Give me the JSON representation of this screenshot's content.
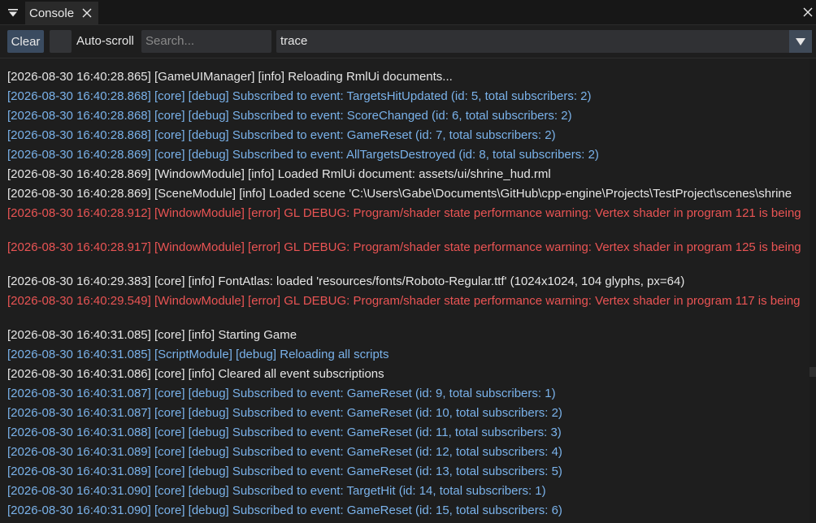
{
  "tab": {
    "label": "Console"
  },
  "toolbar": {
    "clear_label": "Clear",
    "autoscroll_label": "Auto-scroll",
    "autoscroll_checked": false,
    "search_placeholder": "Search...",
    "filter_value": "trace"
  },
  "colors": {
    "info": "#e6e6e6",
    "debug": "#7ab2ea",
    "error": "#ea5454",
    "accent_button": "#3a4b60"
  },
  "log": {
    "clipped_previous": "",
    "lines": [
      {
        "text": "[2026-08-30 16:40:28.865] [GameUIManager] [info] Reloading RmlUi documents...",
        "level": "info",
        "row": 0
      },
      {
        "text": "[2026-08-30 16:40:28.868] [core] [debug] Subscribed to event: TargetsHitUpdated (id: 5, total subscribers: 2)",
        "level": "debug",
        "row": 1
      },
      {
        "text": "[2026-08-30 16:40:28.868] [core] [debug] Subscribed to event: ScoreChanged (id: 6, total subscribers: 2)",
        "level": "debug",
        "row": 2
      },
      {
        "text": "[2026-08-30 16:40:28.868] [core] [debug] Subscribed to event: GameReset (id: 7, total subscribers: 2)",
        "level": "debug",
        "row": 3
      },
      {
        "text": "[2026-08-30 16:40:28.869] [core] [debug] Subscribed to event: AllTargetsDestroyed (id: 8, total subscribers: 2)",
        "level": "debug",
        "row": 4
      },
      {
        "text": "[2026-08-30 16:40:28.869] [WindowModule] [info] Loaded RmlUi document: assets/ui/shrine_hud.rml",
        "level": "info",
        "row": 5
      },
      {
        "text": "[2026-08-30 16:40:28.869] [SceneModule] [info] Loaded scene 'C:\\Users\\Gabe\\Documents\\GitHub\\cpp-engine\\Projects\\TestProject\\scenes\\shrine",
        "level": "info",
        "row": 6
      },
      {
        "text": "[2026-08-30 16:40:28.912] [WindowModule] [error] GL DEBUG: Program/shader state performance warning: Vertex shader in program 121 is being",
        "level": "error",
        "row": 7
      },
      {
        "text": "[2026-08-30 16:40:28.917] [WindowModule] [error] GL DEBUG: Program/shader state performance warning: Vertex shader in program 125 is being",
        "level": "error",
        "row": 8.75
      },
      {
        "text": "[2026-08-30 16:40:29.383] [core] [info] FontAtlas: loaded 'resources/fonts/Roboto-Regular.ttf' (1024x1024, 104 glyphs, px=64)",
        "level": "info",
        "row": 10.5
      },
      {
        "text": "[2026-08-30 16:40:29.549] [WindowModule] [error] GL DEBUG: Program/shader state performance warning: Vertex shader in program 117 is being",
        "level": "error",
        "row": 11.5
      },
      {
        "text": "[2026-08-30 16:40:31.085] [core] [info] Starting Game",
        "level": "info",
        "row": 13.25
      },
      {
        "text": "[2026-08-30 16:40:31.085] [ScriptModule] [debug] Reloading all scripts",
        "level": "debug",
        "row": 14.25
      },
      {
        "text": "[2026-08-30 16:40:31.086] [core] [info] Cleared all event subscriptions",
        "level": "info",
        "row": 15.25
      },
      {
        "text": "[2026-08-30 16:40:31.087] [core] [debug] Subscribed to event: GameReset (id: 9, total subscribers: 1)",
        "level": "debug",
        "row": 16.25
      },
      {
        "text": "[2026-08-30 16:40:31.087] [core] [debug] Subscribed to event: GameReset (id: 10, total subscribers: 2)",
        "level": "debug",
        "row": 17.25
      },
      {
        "text": "[2026-08-30 16:40:31.088] [core] [debug] Subscribed to event: GameReset (id: 11, total subscribers: 3)",
        "level": "debug",
        "row": 18.25
      },
      {
        "text": "[2026-08-30 16:40:31.089] [core] [debug] Subscribed to event: GameReset (id: 12, total subscribers: 4)",
        "level": "debug",
        "row": 19.25
      },
      {
        "text": "[2026-08-30 16:40:31.089] [core] [debug] Subscribed to event: GameReset (id: 13, total subscribers: 5)",
        "level": "debug",
        "row": 20.25
      },
      {
        "text": "[2026-08-30 16:40:31.090] [core] [debug] Subscribed to event: TargetHit (id: 14, total subscribers: 1)",
        "level": "debug",
        "row": 21.25
      },
      {
        "text": "[2026-08-30 16:40:31.090] [core] [debug] Subscribed to event: GameReset (id: 15, total subscribers: 6)",
        "level": "debug",
        "row": 22.25
      }
    ]
  }
}
